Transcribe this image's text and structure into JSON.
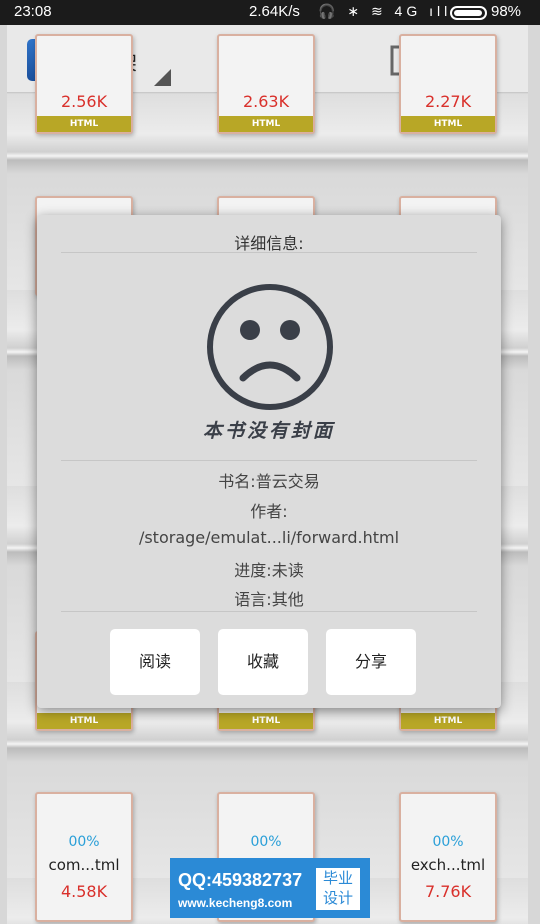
{
  "status_bar": {
    "time": "23:08",
    "speed": "2.64K/s",
    "icons": "🎧 ∗ ≋ 4G ıll",
    "battery_level": 0.98,
    "battery_text": "98%"
  },
  "toolbar": {
    "logo_text": "YI",
    "title": "书架",
    "edit_icon": "edit-icon",
    "more_icon": "more-vert-icon"
  },
  "shelf": {
    "top_row": [
      {
        "size": "2.56K",
        "badge": "HTML"
      },
      {
        "size": "2.63K",
        "badge": "HTML"
      },
      {
        "size": "2.27K",
        "badge": "HTML"
      }
    ],
    "mid_row": [
      {
        "badge": "HTML"
      },
      {
        "badge": "HTML"
      },
      {
        "badge": "HTML"
      }
    ],
    "bottom_row": [
      {
        "progress": "00%",
        "name": "com...tml",
        "size": "4.58K"
      },
      {
        "progress": "00%",
        "name": "",
        "size": ""
      },
      {
        "progress": "00%",
        "name": "exch...tml",
        "size": "7.76K"
      }
    ]
  },
  "dialog": {
    "title": "详细信息:",
    "no_cover_text": "本书没有封面",
    "book_name": "书名:普云交易",
    "author_label": "作者:",
    "path": "/storage/emulat...li/forward.html",
    "progress": "进度:未读",
    "language": "语言:其他",
    "buttons": {
      "read": "阅读",
      "favorite": "收藏",
      "share": "分享"
    }
  },
  "watermark": {
    "qq": "QQ:459382737",
    "url": "www.kecheng8.com",
    "badge_line1": "毕业",
    "badge_line2": "设计"
  }
}
